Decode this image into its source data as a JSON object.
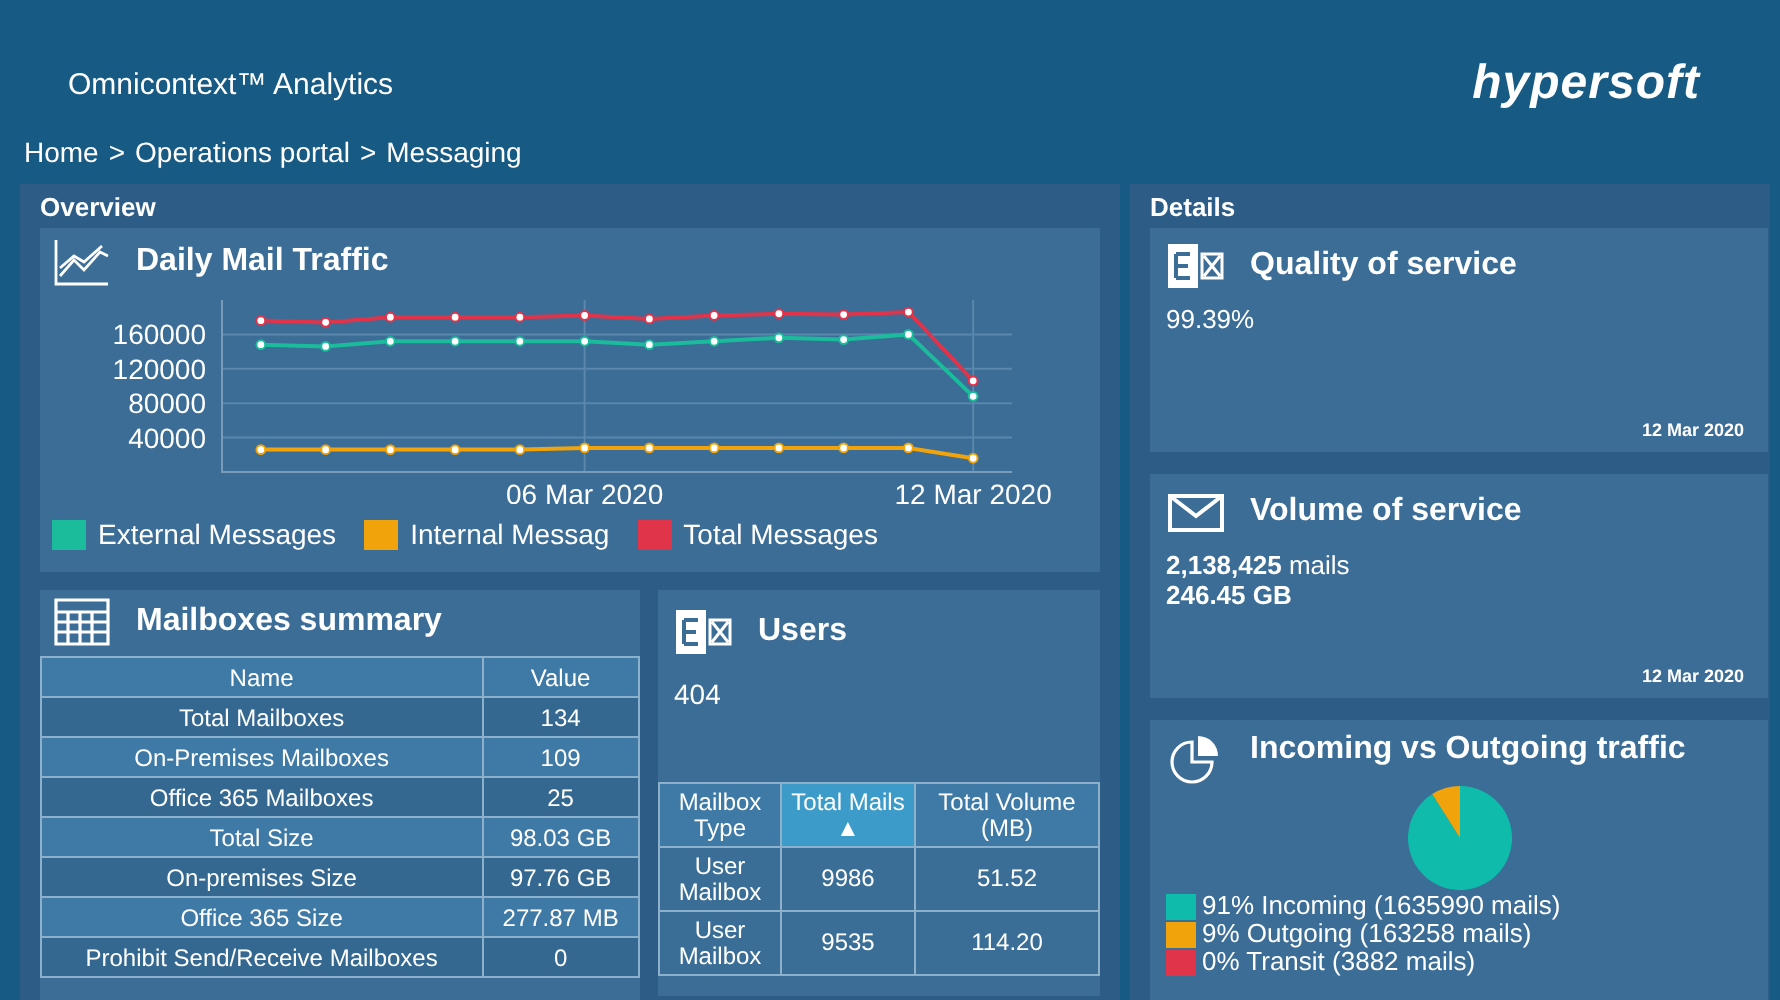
{
  "header": {
    "app_title": "Omnicontext™ Analytics",
    "logo": "hypersoft"
  },
  "breadcrumb": [
    "Home",
    ">",
    "Operations portal",
    ">",
    "Messaging"
  ],
  "overview": {
    "title": "Overview",
    "traffic": {
      "title": "Daily Mail Traffic",
      "chart_data": {
        "type": "line",
        "categories": [
          null,
          null,
          null,
          null,
          null,
          "06 Mar 2020",
          null,
          null,
          null,
          null,
          null,
          "12 Mar 2020"
        ],
        "ylim": [
          0,
          200000
        ],
        "grid": true,
        "yticks": [
          {
            "value": 40000,
            "label": "40000"
          },
          {
            "value": 80000,
            "label": "80000"
          },
          {
            "value": 120000,
            "label": "120000"
          },
          {
            "value": 160000,
            "label": "160000"
          }
        ],
        "series": [
          {
            "name": "External Messages",
            "color": "#1abc9c",
            "marker": "circle",
            "values": [
              148000,
              146000,
              152000,
              152000,
              152000,
              152000,
              148000,
              152000,
              156000,
              154000,
              160000,
              88000
            ]
          },
          {
            "name": "Internal Messag",
            "color": "#f0a30a",
            "marker": "circle",
            "values": [
              26000,
              26000,
              26000,
              26000,
              26000,
              28000,
              28000,
              28000,
              28000,
              28000,
              28000,
              16000
            ]
          },
          {
            "name": "Total Messages",
            "color": "#e0344b",
            "marker": "circle",
            "values": [
              176000,
              174000,
              180000,
              180000,
              180000,
              182000,
              178000,
              182000,
              184000,
              183000,
              186000,
              106000
            ]
          }
        ]
      }
    },
    "mailboxes": {
      "title": "Mailboxes summary",
      "columns": [
        "Name",
        "Value"
      ],
      "rows": [
        [
          "Total Mailboxes",
          "134"
        ],
        [
          "On-Premises Mailboxes",
          "109"
        ],
        [
          "Office 365 Mailboxes",
          "25"
        ],
        [
          "Total Size",
          "98.03 GB"
        ],
        [
          "On-premises Size",
          "97.76 GB"
        ],
        [
          "Office 365 Size",
          "277.87 MB"
        ],
        [
          "Prohibit Send/Receive Mailboxes",
          "0"
        ]
      ]
    },
    "users": {
      "title": "Users",
      "value": "404",
      "columns": [
        {
          "label": "Mailbox Type",
          "selected": false
        },
        {
          "label": "Total Mails",
          "selected": true,
          "sort_arrow": "▲"
        },
        {
          "label": "Total Volume (MB)",
          "selected": false
        }
      ],
      "rows": [
        [
          "User Mailbox",
          "9986",
          "51.52"
        ],
        [
          "User Mailbox",
          "9535",
          "114.20"
        ]
      ]
    }
  },
  "details": {
    "title": "Details",
    "cards": [
      {
        "kind": "exchange",
        "title": "Quality of service",
        "lines": [
          "99.39%"
        ],
        "date": "12 Mar 2020"
      },
      {
        "kind": "mail",
        "title": "Volume of service",
        "lines": [
          "**2,138,425** mails",
          "**246.45 GB**"
        ],
        "date": "12 Mar 2020"
      },
      {
        "kind": "pie",
        "title": "Incoming vs Outgoing traffic",
        "chart_data": {
          "type": "pie",
          "categories": [
            "91% Incoming (1635990 mails)",
            "9% Outgoing (163258 mails)",
            "0% Transit (3882 mails)"
          ],
          "values": [
            91,
            9,
            0
          ],
          "colors": [
            "#0fbcab",
            "#f0a30a",
            "#e0344b"
          ]
        }
      }
    ]
  }
}
